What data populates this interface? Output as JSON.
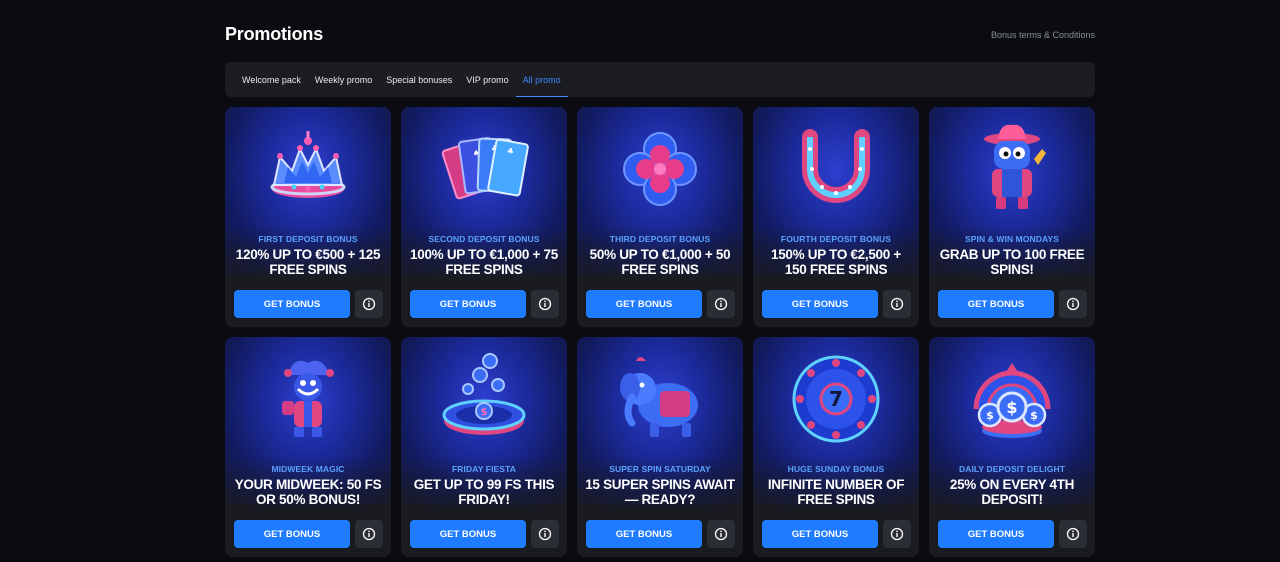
{
  "header": {
    "title": "Promotions",
    "terms_link": "Bonus terms & Conditions"
  },
  "tabs": [
    {
      "label": "Welcome pack",
      "active": false
    },
    {
      "label": "Weekly promo",
      "active": false
    },
    {
      "label": "Special bonuses",
      "active": false
    },
    {
      "label": "VIP promo",
      "active": false
    },
    {
      "label": "All promo",
      "active": true
    }
  ],
  "colors": {
    "background": "#0b0c10",
    "accent": "#1f7bff",
    "subtitle": "#5aa2ff",
    "card": "#191b21"
  },
  "cards": [
    {
      "icon": "crown-icon",
      "subtitle": "FIRST DEPOSIT BONUS",
      "headline": "120% UP TO €500 + 125 FREE SPINS",
      "button": "GET BONUS"
    },
    {
      "icon": "playing-cards-icon",
      "subtitle": "SECOND DEPOSIT BONUS",
      "headline": "100% UP TO €1,000 + 75 FREE SPINS",
      "button": "GET BONUS"
    },
    {
      "icon": "clover-icon",
      "subtitle": "THIRD DEPOSIT BONUS",
      "headline": "50% UP TO €1,000 + 50 FREE SPINS",
      "button": "GET BONUS"
    },
    {
      "icon": "horseshoe-icon",
      "subtitle": "FOURTH DEPOSIT BONUS",
      "headline": "150% UP TO €2,500 + 150 FREE SPINS",
      "button": "GET BONUS"
    },
    {
      "icon": "cowboy-mascot-icon",
      "subtitle": "SPIN & WIN MONDAYS",
      "headline": "GRAB UP TO 100 FREE SPINS!",
      "button": "GET BONUS"
    },
    {
      "icon": "jester-icon",
      "subtitle": "MIDWEEK MAGIC",
      "headline": "YOUR MIDWEEK: 50 FS OR 50% BONUS!",
      "button": "GET BONUS"
    },
    {
      "icon": "coin-portal-icon",
      "subtitle": "FRIDAY FIESTA",
      "headline": "GET UP TO 99 FS THIS FRIDAY!",
      "button": "GET BONUS"
    },
    {
      "icon": "elephant-icon",
      "subtitle": "SUPER SPIN SATURDAY",
      "headline": "15 SUPER SPINS AWAIT — READY?",
      "button": "GET BONUS"
    },
    {
      "icon": "lucky-seven-wheel-icon",
      "subtitle": "HUGE SUNDAY BONUS",
      "headline": "INFINITE NUMBER OF FREE SPINS",
      "button": "GET BONUS"
    },
    {
      "icon": "dollar-coins-icon",
      "subtitle": "DAILY DEPOSIT DELIGHT",
      "headline": "25% ON EVERY 4TH DEPOSIT!",
      "button": "GET BONUS"
    }
  ]
}
